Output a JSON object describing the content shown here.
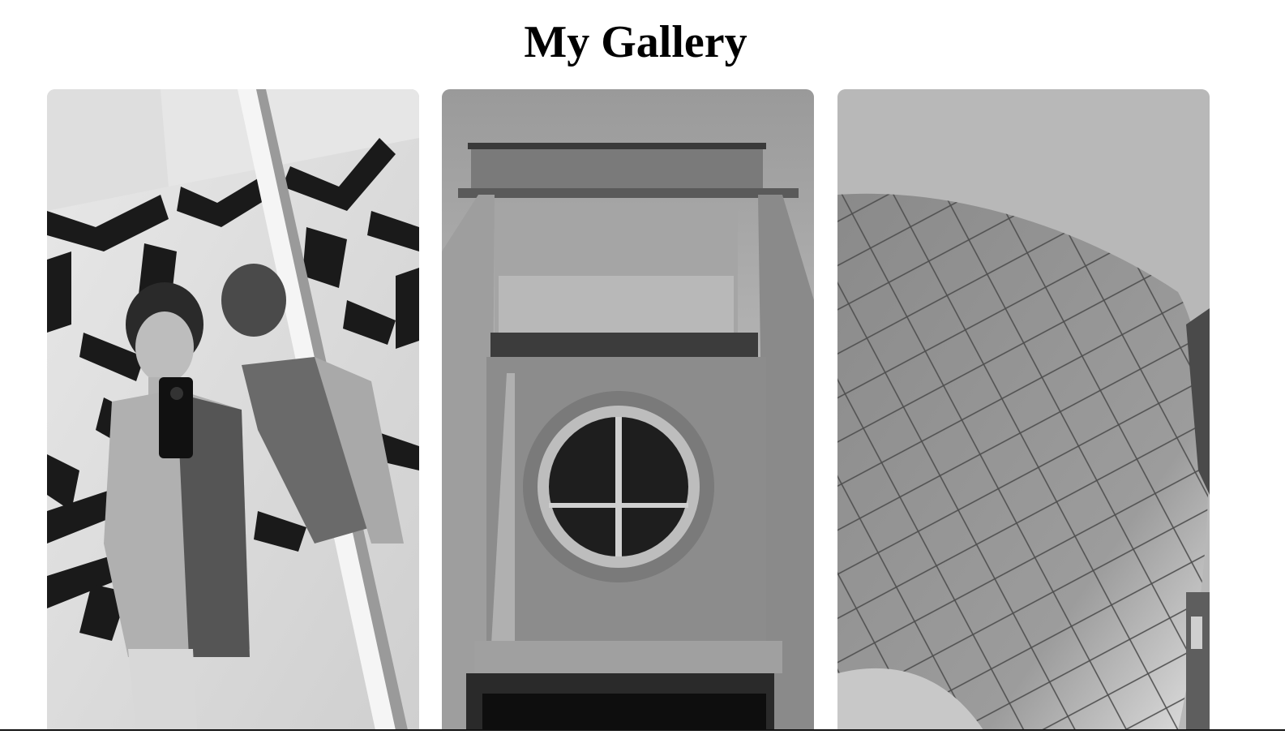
{
  "page": {
    "title": "My Gallery"
  },
  "gallery": {
    "images": [
      {
        "subject": "mirror-selfie",
        "tone": "black-and-white"
      },
      {
        "subject": "building-round-window",
        "tone": "black-and-white"
      },
      {
        "subject": "curved-metal-facade",
        "tone": "black-and-white"
      }
    ]
  },
  "colors": {
    "background": "#ffffff",
    "title": "#000000",
    "rule": "#111111"
  }
}
